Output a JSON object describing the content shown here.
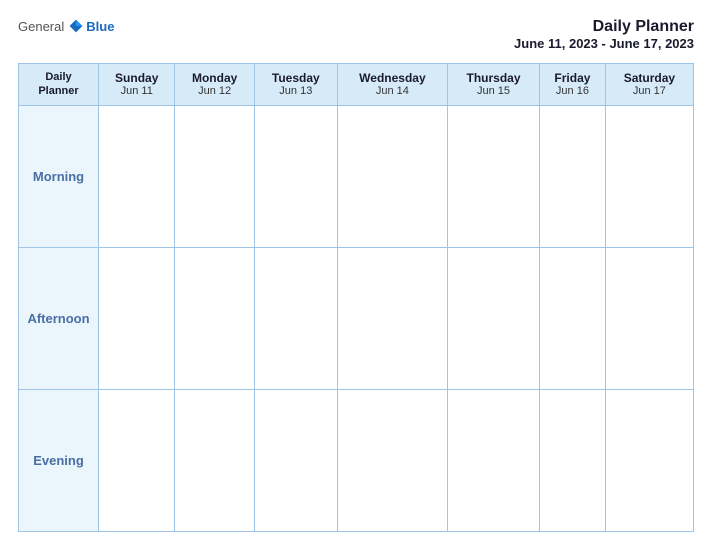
{
  "header": {
    "logo": {
      "general": "General",
      "blue": "Blue",
      "icon_color": "#1a6bbf"
    },
    "title": "Daily Planner",
    "date_range": "June 11, 2023 - June 17, 2023"
  },
  "columns": [
    {
      "label": "Daily\nPlanner",
      "day": "",
      "date": "",
      "is_label": true
    },
    {
      "label": "Sunday",
      "day": "Sunday",
      "date": "Jun 11"
    },
    {
      "label": "Monday",
      "day": "Monday",
      "date": "Jun 12"
    },
    {
      "label": "Tuesday",
      "day": "Tuesday",
      "date": "Jun 13"
    },
    {
      "label": "Wednesday",
      "day": "Wednesday",
      "date": "Jun 14"
    },
    {
      "label": "Thursday",
      "day": "Thursday",
      "date": "Jun 15"
    },
    {
      "label": "Friday",
      "day": "Friday",
      "date": "Jun 16"
    },
    {
      "label": "Saturday",
      "day": "Saturday",
      "date": "Jun 17"
    }
  ],
  "rows": [
    {
      "label": "Morning"
    },
    {
      "label": "Afternoon"
    },
    {
      "label": "Evening"
    }
  ]
}
